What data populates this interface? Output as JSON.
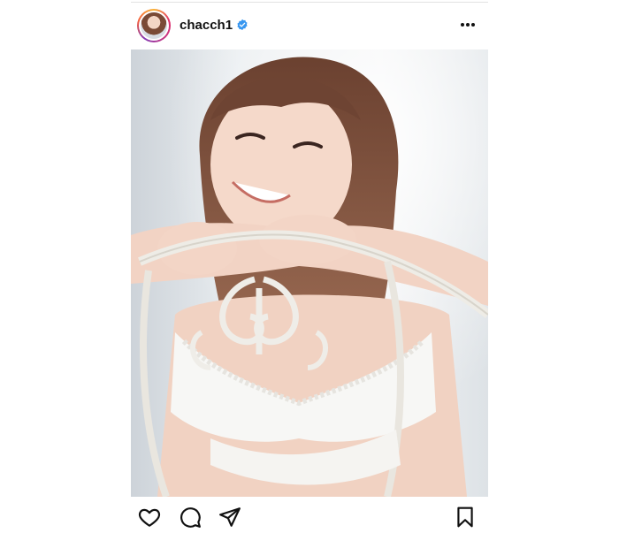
{
  "post": {
    "username": "chacch1",
    "verified": true,
    "more_icon": "more-horizontal-icon",
    "photo_icon": "photo",
    "actions": {
      "like_icon": "heart-icon",
      "comment_icon": "comment-icon",
      "share_icon": "paper-plane-icon",
      "save_icon": "bookmark-icon"
    }
  },
  "colors": {
    "verified_badge": "#3897f0",
    "text": "#111111",
    "divider": "#e2e2e2"
  }
}
